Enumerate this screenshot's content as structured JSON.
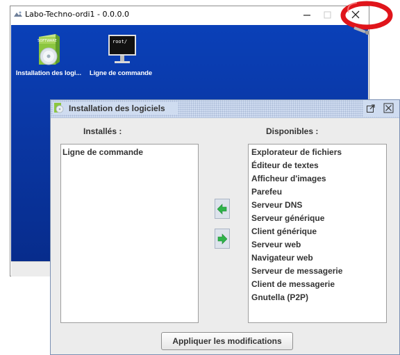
{
  "window": {
    "title": "Labo-Techno-ordi1 - 0.0.0.0",
    "controls": [
      "minimize-icon",
      "maximize-icon",
      "close-icon"
    ]
  },
  "desktop": {
    "icons": [
      {
        "label": "Installation des logi...",
        "icon": "software-box-icon",
        "box_text": "SOFTWARE"
      },
      {
        "label": "Ligne de commande",
        "icon": "terminal-icon",
        "screen_text": "root/"
      }
    ]
  },
  "dialog": {
    "title": "Installation des logiciels",
    "installed_header": "Installés :",
    "available_header": "Disponibles :",
    "installed": [
      "Ligne de commande"
    ],
    "available": [
      "Explorateur de fichiers",
      "Éditeur de textes",
      "Afficheur d'images",
      "Parefeu",
      "Serveur DNS",
      "Serveur générique",
      "Client générique",
      "Serveur web",
      "Navigateur web",
      "Serveur de messagerie",
      "Client de messagerie",
      "Gnutella (P2P)"
    ],
    "apply_label": "Appliquer les modifications",
    "arrow_color": "#2fb34a"
  }
}
